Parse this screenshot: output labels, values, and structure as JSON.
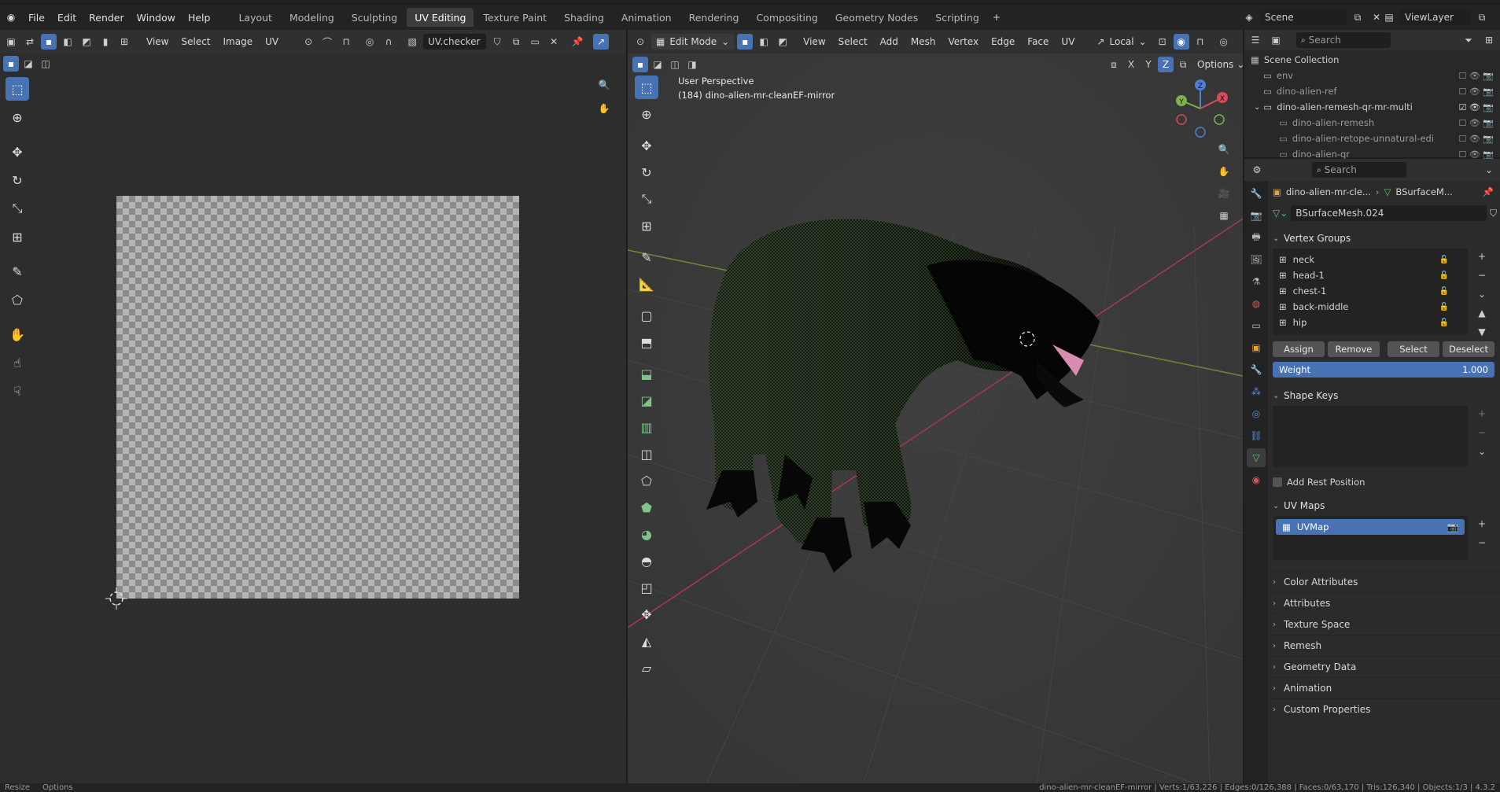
{
  "topbar": {
    "menus": [
      "File",
      "Edit",
      "Render",
      "Window",
      "Help"
    ],
    "workspaces": [
      "Layout",
      "Modeling",
      "Sculpting",
      "UV Editing",
      "Texture Paint",
      "Shading",
      "Animation",
      "Rendering",
      "Compositing",
      "Geometry Nodes",
      "Scripting"
    ],
    "active_workspace": "UV Editing",
    "scene": "Scene",
    "view_layer": "ViewLayer"
  },
  "uv_editor": {
    "menus": [
      "View",
      "Select",
      "Image",
      "UV"
    ],
    "image_name": "UV.checker"
  },
  "viewport": {
    "mode": "Edit Mode",
    "menus": [
      "View",
      "Select",
      "Add",
      "Mesh",
      "Vertex",
      "Edge",
      "Face",
      "UV"
    ],
    "transform_orientation": "Local",
    "options_label": "Options",
    "overlay_title": "User Perspective",
    "overlay_object": "(184) dino-alien-mr-cleanEF-mirror",
    "axes": {
      "x": "X",
      "y": "Y",
      "z": "Z"
    }
  },
  "outliner": {
    "search_placeholder": "Search",
    "root": "Scene Collection",
    "items": [
      {
        "label": "env",
        "depth": 1
      },
      {
        "label": "dino-alien-ref",
        "depth": 1
      },
      {
        "label": "dino-alien-remesh-qr-mr-multi",
        "depth": 1
      },
      {
        "label": "dino-alien-remesh",
        "depth": 2
      },
      {
        "label": "dino-alien-retope-unnatural-edi",
        "depth": 2
      },
      {
        "label": "dino-alien-qr",
        "depth": 2
      }
    ]
  },
  "properties": {
    "search_placeholder": "Search",
    "breadcrumb_object": "dino-alien-mr-cle...",
    "breadcrumb_mesh": "BSurfaceM...",
    "mesh_name": "BSurfaceMesh.024",
    "vertex_groups": {
      "title": "Vertex Groups",
      "items": [
        "neck",
        "head-1",
        "chest-1",
        "back-middle",
        "hip"
      ],
      "buttons": [
        "Assign",
        "Remove",
        "Select",
        "Deselect"
      ],
      "weight_label": "Weight",
      "weight_value": "1.000"
    },
    "shape_keys": {
      "title": "Shape Keys"
    },
    "add_rest_position": "Add Rest Position",
    "uv_maps": {
      "title": "UV Maps",
      "items": [
        "UVMap"
      ]
    },
    "collapsed_panels": [
      "Color Attributes",
      "Attributes",
      "Texture Space",
      "Remesh",
      "Geometry Data",
      "Animation",
      "Custom Properties"
    ]
  },
  "statusbar": {
    "left": [
      "Resize",
      "Options"
    ],
    "right": "dino-alien-mr-cleanEF-mirror | Verts:1/63,226 | Edges:0/126,388 | Faces:0/63,170 | Tris:126,340 | Objects:1/3 | 4.3.2"
  }
}
